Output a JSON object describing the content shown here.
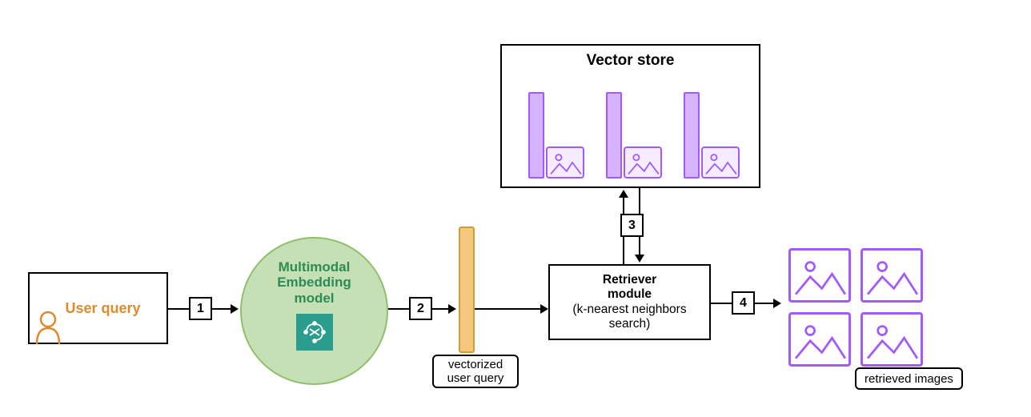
{
  "nodes": {
    "user_query": {
      "label": "User query",
      "icon": "user-icon"
    },
    "embedding_model": {
      "label_line1": "Multimodal",
      "label_line2": "Embedding",
      "label_line3": "model",
      "icon": "chip-icon"
    },
    "vectorized_query": {
      "label": "vectorized\nuser query"
    },
    "vector_store": {
      "label": "Vector store"
    },
    "retriever": {
      "label_line1": "Retriever",
      "label_line2": "module",
      "label_line3": "(k-nearest neighbors",
      "label_line4": "search)"
    },
    "retrieved_images": {
      "label": "retrieved images"
    }
  },
  "steps": {
    "s1": "1",
    "s2": "2",
    "s3": "3",
    "s4": "4"
  },
  "colors": {
    "orange": "#e08a2e",
    "green_circle_bg": "#c5e0b4",
    "green_text": "#2e8b57",
    "teal": "#2a9d8f",
    "bar_fill": "#f5c77e",
    "bar_border": "#d49a3a",
    "purple": "#a259ff",
    "purple_light_fill": "#d5b3ff",
    "purple_border": "#a259ff"
  }
}
